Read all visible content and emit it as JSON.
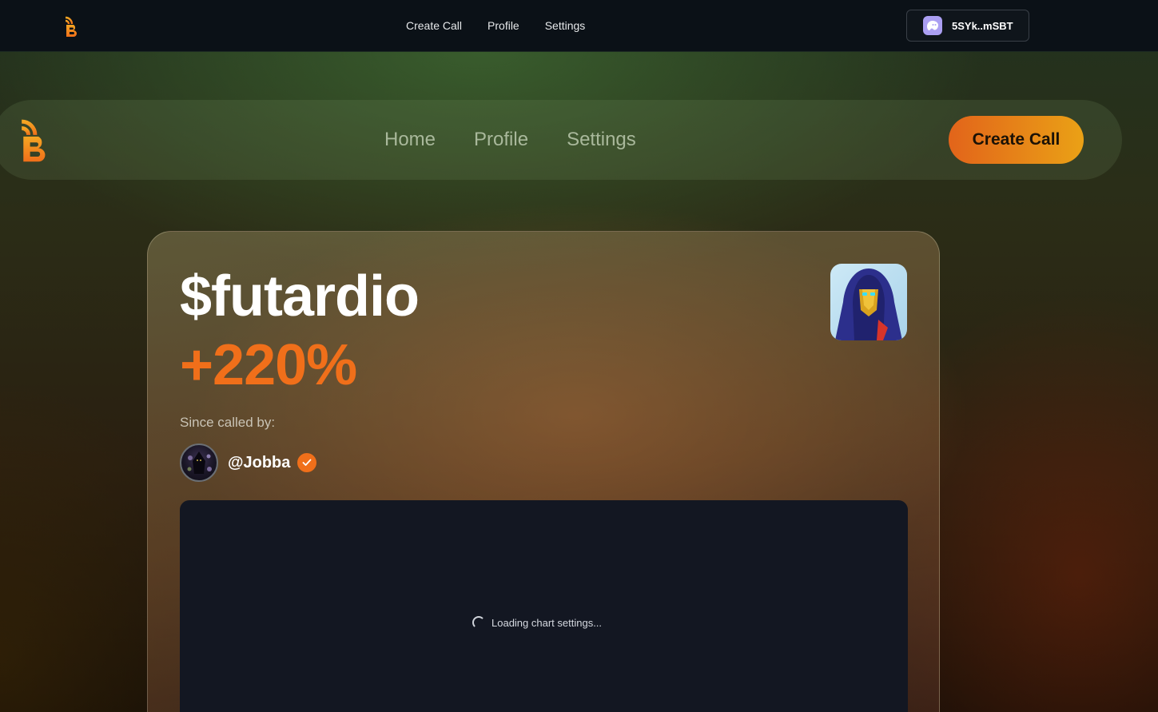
{
  "topbar": {
    "nav": [
      "Create Call",
      "Profile",
      "Settings"
    ],
    "wallet_address": "5SYk..mSBT",
    "wallet_icon": "phantom-ghost-icon"
  },
  "pillbar": {
    "nav": [
      "Home",
      "Profile",
      "Settings"
    ],
    "cta_label": "Create Call"
  },
  "card": {
    "ticker": "$futardio",
    "change": "+220%",
    "since_label": "Since called by:",
    "caller_handle": "@Jobba",
    "verified_icon": "verified-check-icon",
    "chart_loading_text": "Loading chart settings..."
  },
  "colors": {
    "accent_orange": "#f06f1a",
    "cta_gradient_start": "#e2641a",
    "cta_gradient_end": "#eaa116",
    "chart_bg": "#131722"
  }
}
